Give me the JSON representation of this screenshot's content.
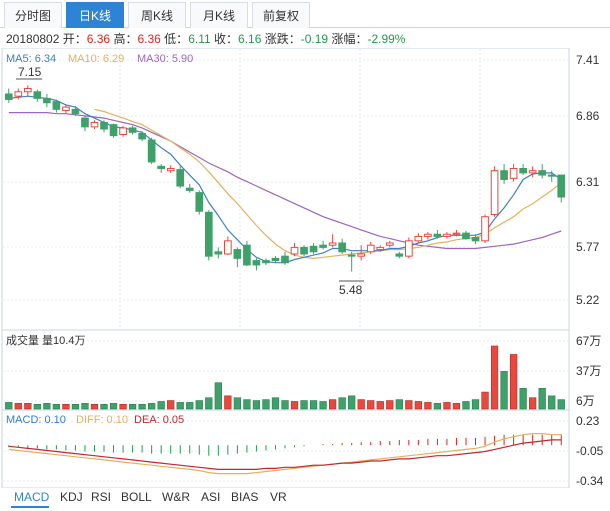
{
  "tabs": [
    "分时图",
    "日K线",
    "周K线",
    "月K线",
    "前复权"
  ],
  "active_tab": 1,
  "info": {
    "date": "20180802",
    "open_label": "开：",
    "open": "6.36",
    "high_label": "高：",
    "high": "6.36",
    "low_label": "低：",
    "low": "6.11",
    "close_label": "收：",
    "close": "6.16",
    "change_label": "涨跌：",
    "change": "-0.19",
    "pct_label": "涨幅：",
    "pct": "-2.99%"
  },
  "ma_legend": {
    "ma5": "MA5: 6.34",
    "ma10": "MA10: 6.29",
    "ma30": "MA30: 5.90"
  },
  "colors": {
    "up": "#e0241b",
    "down": "#1e9c4d",
    "up_candle": "#e8493f",
    "down_candle": "#3fa06a",
    "ma5": "#3f7fc9",
    "ma10": "#e5b15d",
    "ma30": "#9b67c0",
    "macd": "#2f7fd0",
    "diff": "#e5b15d",
    "dea": "#c0282e",
    "active": "#2f83d5"
  },
  "price_axis": {
    "ticks": [
      "7.41",
      "6.86",
      "6.31",
      "5.77",
      "5.22"
    ],
    "min": 5.22,
    "max": 7.41
  },
  "annotations": {
    "high": "7.15",
    "low": "5.48"
  },
  "volume": {
    "title": "成交量 量10.4万",
    "ticks": [
      "67万",
      "37万",
      "6万"
    ],
    "max": 67
  },
  "macd": {
    "legend_macd": "MACD: 0.10",
    "legend_diff": "DIFF: 0.10",
    "legend_dea": "DEA: 0.05",
    "ticks": [
      "0.23",
      "-0.05",
      "-0.34"
    ],
    "min": -0.34,
    "max": 0.23
  },
  "indicator_tabs": [
    "MACD",
    "KDJ",
    "RSI",
    "BOLL",
    "W&R",
    "ASI",
    "BIAS",
    "VR"
  ],
  "active_indicator": 0,
  "chart_data": {
    "type": "candlestick",
    "candles": [
      [
        7.1,
        7.05,
        7.15,
        7.02
      ],
      [
        7.08,
        7.12,
        7.15,
        7.05
      ],
      [
        7.12,
        7.15,
        7.18,
        7.08
      ],
      [
        7.12,
        7.06,
        7.14,
        7.03
      ],
      [
        7.06,
        7.02,
        7.1,
        6.98
      ],
      [
        7.03,
        6.96,
        7.05,
        6.93
      ],
      [
        6.95,
        6.98,
        7.0,
        6.92
      ],
      [
        6.96,
        6.92,
        6.99,
        6.9
      ],
      [
        6.88,
        6.8,
        6.9,
        6.76
      ],
      [
        6.8,
        6.84,
        6.86,
        6.78
      ],
      [
        6.84,
        6.78,
        6.86,
        6.75
      ],
      [
        6.82,
        6.72,
        6.83,
        6.7
      ],
      [
        6.73,
        6.79,
        6.81,
        6.71
      ],
      [
        6.79,
        6.75,
        6.81,
        6.73
      ],
      [
        6.74,
        6.69,
        6.76,
        6.67
      ],
      [
        6.68,
        6.48,
        6.7,
        6.46
      ],
      [
        6.44,
        6.42,
        6.46,
        6.38
      ],
      [
        6.4,
        6.42,
        6.45,
        6.38
      ],
      [
        6.41,
        6.26,
        6.44,
        6.24
      ],
      [
        6.24,
        6.22,
        6.28,
        6.2
      ],
      [
        6.2,
        6.03,
        6.22,
        6.0
      ],
      [
        6.02,
        5.62,
        6.04,
        5.58
      ],
      [
        5.66,
        5.64,
        5.7,
        5.6
      ],
      [
        5.64,
        5.76,
        5.8,
        5.63
      ],
      [
        5.68,
        5.6,
        5.7,
        5.52
      ],
      [
        5.72,
        5.54,
        5.76,
        5.53
      ],
      [
        5.58,
        5.54,
        5.6,
        5.49
      ],
      [
        5.58,
        5.56,
        5.6,
        5.54
      ],
      [
        5.6,
        5.58,
        5.62,
        5.56
      ],
      [
        5.62,
        5.56,
        5.66,
        5.54
      ],
      [
        5.64,
        5.7,
        5.74,
        5.62
      ],
      [
        5.7,
        5.64,
        5.72,
        5.62
      ],
      [
        5.71,
        5.66,
        5.74,
        5.64
      ],
      [
        5.72,
        5.7,
        5.76,
        5.68
      ],
      [
        5.72,
        5.74,
        5.82,
        5.7
      ],
      [
        5.74,
        5.66,
        5.78,
        5.64
      ],
      [
        5.63,
        5.62,
        5.66,
        5.48
      ],
      [
        5.62,
        5.64,
        5.72,
        5.58
      ],
      [
        5.66,
        5.72,
        5.75,
        5.64
      ],
      [
        5.68,
        5.7,
        5.72,
        5.66
      ],
      [
        5.72,
        5.74,
        5.76,
        5.7
      ],
      [
        5.64,
        5.62,
        5.66,
        5.6
      ],
      [
        5.62,
        5.76,
        5.79,
        5.6
      ],
      [
        5.76,
        5.8,
        5.83,
        5.74
      ],
      [
        5.8,
        5.82,
        5.84,
        5.77
      ],
      [
        5.82,
        5.8,
        5.86,
        5.78
      ],
      [
        5.8,
        5.82,
        5.84,
        5.78
      ],
      [
        5.82,
        5.83,
        5.86,
        5.8
      ],
      [
        5.83,
        5.78,
        5.85,
        5.77
      ],
      [
        5.79,
        5.76,
        5.82,
        5.73
      ],
      [
        5.76,
        5.98,
        6.0,
        5.74
      ],
      [
        6.0,
        6.4,
        6.44,
        5.98
      ],
      [
        6.4,
        6.32,
        6.46,
        6.28
      ],
      [
        6.33,
        6.42,
        6.46,
        6.3
      ],
      [
        6.42,
        6.38,
        6.46,
        6.36
      ],
      [
        6.38,
        6.4,
        6.44,
        6.34
      ],
      [
        6.4,
        6.36,
        6.46,
        6.33
      ],
      [
        6.36,
        6.35,
        6.4,
        6.3
      ],
      [
        6.36,
        6.16,
        6.36,
        6.11
      ]
    ],
    "ma5": [
      7.06,
      7.07,
      7.08,
      7.07,
      7.06,
      7.04,
      7.0,
      6.98,
      6.92,
      6.88,
      6.84,
      6.8,
      6.79,
      6.77,
      6.75,
      6.68,
      6.61,
      6.55,
      6.45,
      6.36,
      6.27,
      6.11,
      5.99,
      5.86,
      5.77,
      5.68,
      5.61,
      5.57,
      5.56,
      5.56,
      5.59,
      5.61,
      5.63,
      5.65,
      5.69,
      5.69,
      5.67,
      5.67,
      5.67,
      5.67,
      5.69,
      5.69,
      5.71,
      5.74,
      5.76,
      5.79,
      5.81,
      5.81,
      5.81,
      5.81,
      5.84,
      5.96,
      6.06,
      6.18,
      6.32,
      6.37,
      6.38,
      6.38,
      6.32
    ],
    "ma10": [
      null,
      null,
      null,
      null,
      null,
      null,
      null,
      null,
      null,
      6.96,
      6.94,
      6.91,
      6.88,
      6.85,
      6.82,
      6.77,
      6.72,
      6.67,
      6.61,
      6.55,
      6.48,
      6.39,
      6.29,
      6.19,
      6.1,
      6.0,
      5.9,
      5.81,
      5.73,
      5.67,
      5.63,
      5.61,
      5.6,
      5.61,
      5.62,
      5.63,
      5.64,
      5.65,
      5.66,
      5.67,
      5.68,
      5.68,
      5.69,
      5.7,
      5.72,
      5.74,
      5.75,
      5.77,
      5.78,
      5.79,
      5.82,
      5.88,
      5.93,
      5.98,
      6.05,
      6.1,
      6.16,
      6.22,
      6.29
    ],
    "ma30": [
      6.93,
      6.93,
      6.93,
      6.93,
      6.93,
      6.92,
      6.92,
      6.91,
      6.9,
      6.89,
      6.88,
      6.86,
      6.84,
      6.82,
      6.79,
      6.75,
      6.71,
      6.67,
      6.62,
      6.57,
      6.52,
      6.47,
      6.43,
      6.39,
      6.34,
      6.3,
      6.26,
      6.22,
      6.18,
      6.14,
      6.1,
      6.06,
      6.02,
      5.98,
      5.95,
      5.92,
      5.89,
      5.86,
      5.83,
      5.8,
      5.78,
      5.76,
      5.74,
      5.72,
      5.71,
      5.7,
      5.69,
      5.69,
      5.69,
      5.69,
      5.7,
      5.71,
      5.72,
      5.73,
      5.75,
      5.77,
      5.79,
      5.82,
      5.85
    ],
    "volume": [
      7,
      6,
      6,
      5,
      6,
      5,
      5,
      5,
      6,
      5,
      5,
      6,
      5,
      5,
      5,
      6,
      8,
      9,
      7,
      7,
      9,
      12,
      28,
      14,
      12,
      10,
      9,
      10,
      12,
      9,
      8,
      9,
      9,
      8,
      10,
      12,
      14,
      10,
      9,
      8,
      9,
      10,
      9,
      8,
      7,
      6,
      7,
      6,
      8,
      10,
      18,
      67,
      40,
      58,
      22,
      12,
      22,
      14,
      10
    ],
    "macd_bars": [
      -0.02,
      -0.02,
      -0.03,
      -0.03,
      -0.04,
      -0.04,
      -0.05,
      -0.05,
      -0.06,
      -0.06,
      -0.06,
      -0.07,
      -0.07,
      -0.07,
      -0.07,
      -0.08,
      -0.08,
      -0.08,
      -0.08,
      -0.08,
      -0.09,
      -0.1,
      -0.1,
      -0.09,
      -0.08,
      -0.07,
      -0.06,
      -0.05,
      -0.04,
      -0.03,
      -0.02,
      -0.01,
      0.0,
      0.01,
      0.01,
      0.02,
      0.02,
      0.03,
      0.03,
      0.04,
      0.04,
      0.05,
      0.05,
      0.05,
      0.06,
      0.06,
      0.06,
      0.07,
      0.07,
      0.07,
      0.08,
      0.09,
      0.1,
      0.1,
      0.1,
      0.1,
      0.1,
      0.1,
      0.1
    ],
    "diff": [
      -0.04,
      -0.05,
      -0.06,
      -0.07,
      -0.08,
      -0.09,
      -0.1,
      -0.11,
      -0.12,
      -0.13,
      -0.14,
      -0.15,
      -0.16,
      -0.17,
      -0.18,
      -0.19,
      -0.2,
      -0.21,
      -0.22,
      -0.23,
      -0.24,
      -0.26,
      -0.27,
      -0.27,
      -0.27,
      -0.27,
      -0.26,
      -0.25,
      -0.24,
      -0.23,
      -0.22,
      -0.21,
      -0.2,
      -0.19,
      -0.18,
      -0.17,
      -0.16,
      -0.15,
      -0.14,
      -0.13,
      -0.12,
      -0.11,
      -0.1,
      -0.09,
      -0.08,
      -0.07,
      -0.06,
      -0.05,
      -0.04,
      -0.03,
      -0.01,
      0.03,
      0.06,
      0.08,
      0.1,
      0.11,
      0.11,
      0.1,
      0.1
    ],
    "dea": [
      -0.01,
      -0.02,
      -0.03,
      -0.04,
      -0.05,
      -0.06,
      -0.07,
      -0.08,
      -0.09,
      -0.1,
      -0.11,
      -0.12,
      -0.13,
      -0.14,
      -0.15,
      -0.16,
      -0.17,
      -0.18,
      -0.19,
      -0.2,
      -0.21,
      -0.22,
      -0.23,
      -0.23,
      -0.23,
      -0.23,
      -0.23,
      -0.22,
      -0.22,
      -0.21,
      -0.21,
      -0.2,
      -0.19,
      -0.19,
      -0.18,
      -0.17,
      -0.17,
      -0.16,
      -0.15,
      -0.15,
      -0.14,
      -0.13,
      -0.13,
      -0.12,
      -0.11,
      -0.1,
      -0.1,
      -0.09,
      -0.08,
      -0.07,
      -0.06,
      -0.04,
      -0.02,
      0.0,
      0.02,
      0.03,
      0.04,
      0.05,
      0.05
    ]
  }
}
